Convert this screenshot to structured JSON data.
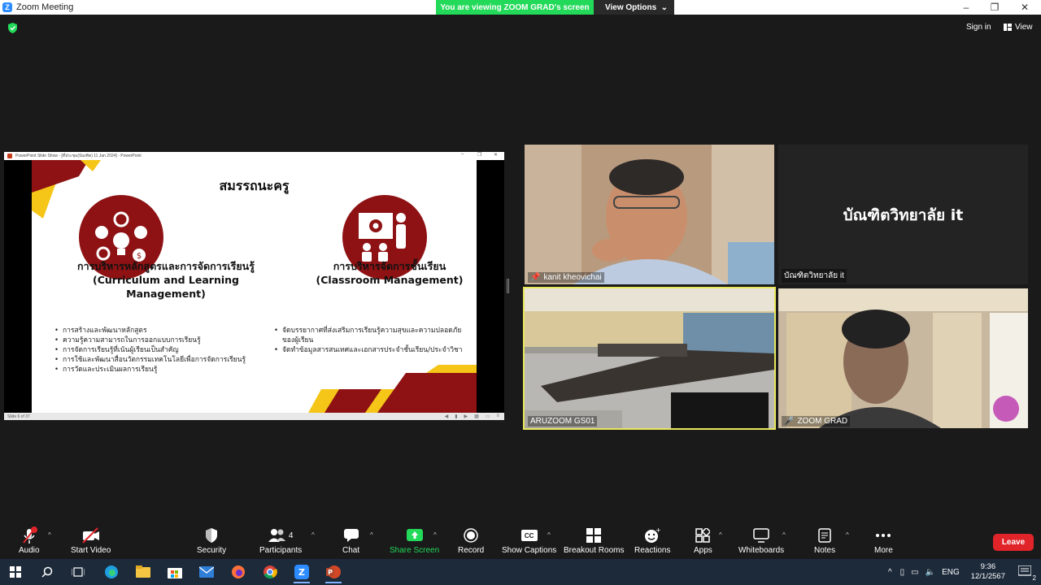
{
  "window": {
    "title": "Zoom Meeting",
    "minimize": "–",
    "maximize": "❐",
    "close": "✕"
  },
  "share_banner": {
    "message": "You are viewing ZOOM GRAD's screen",
    "options_label": "View Options",
    "options_caret": "⌄"
  },
  "top_right": {
    "sign_in": "Sign in",
    "view": "View"
  },
  "shared_screen": {
    "ppt_title": "PowerPoint Slide Show - [ที่ประชุม(บัณฑิต) 11 Jan 2024] - PowerPoint",
    "status": "Slide 6 of 37",
    "slide": {
      "title": "สมรรถนะครู",
      "left": {
        "heading_th": "การบริหารหลักสูตรและการจัดการเรียนรู้",
        "heading_en": "(Curriculum and Learning Management)",
        "bullets": [
          "การสร้างและพัฒนาหลักสูตร",
          "ความรู้ความสามารถในการออกแบบการเรียนรู้",
          "การจัดการเรียนรู้ที่เน้นผู้เรียนเป็นสำคัญ",
          "การใช้และพัฒนาสื่อนวัตกรรมเทคโนโลยีเพื่อการจัดการเรียนรู้",
          "การวัดและประเมินผลการเรียนรู้"
        ]
      },
      "right": {
        "heading_th": "การบริหารจัดการชั้นเรียน",
        "heading_en": "(Classroom Management)",
        "bullets": [
          "จัดบรรยากาศที่ส่งเสริมการเรียนรู้ความสุขและความปลอดภัยของผู้เรียน",
          "จัดทำข้อมูลสารสนเทศและเอกสารประจำชั้นเรียน/ประจำวิชา"
        ]
      }
    }
  },
  "participants_tiles": [
    {
      "name": "kanit kheovichai",
      "pinned": true
    },
    {
      "name": "บัณฑิตวิทยาลัย  it",
      "display_name": "บัณฑิตวิทยาลัย  it"
    },
    {
      "name": "ARUZOOM GS01",
      "active_speaker": true
    },
    {
      "name": "ZOOM GRAD",
      "muted": true
    }
  ],
  "toolbar": {
    "audio": "Audio",
    "start_video": "Start Video",
    "security": "Security",
    "participants": "Participants",
    "participants_count": "4",
    "chat": "Chat",
    "share_screen": "Share Screen",
    "record": "Record",
    "show_captions": "Show Captions",
    "breakout_rooms": "Breakout Rooms",
    "reactions": "Reactions",
    "apps": "Apps",
    "whiteboards": "Whiteboards",
    "notes": "Notes",
    "more": "More",
    "leave": "Leave",
    "cc": "CC"
  },
  "taskbar": {
    "language": "ENG",
    "time": "9:36",
    "date": "12/1/2567",
    "notifications": "2"
  },
  "colors": {
    "zoom_blue": "#2d8cff",
    "share_green": "#23d959",
    "leave_red": "#e0242a",
    "slide_red": "#8e1214",
    "slide_yellow": "#f5c518",
    "active_speaker": "#e7e75c"
  }
}
